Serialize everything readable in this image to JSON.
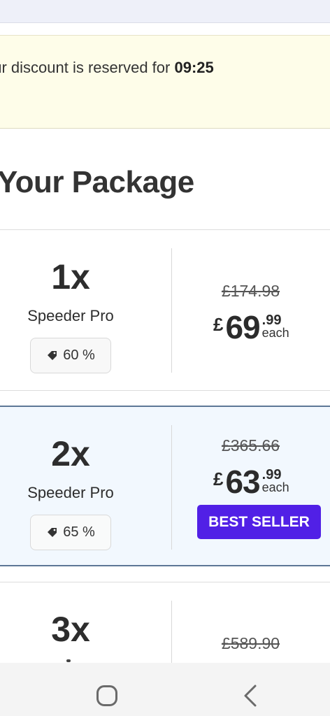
{
  "banner": {
    "text": "our discount is reserved for ",
    "timer": "09:25"
  },
  "package_title": "Your Package",
  "packages": [
    {
      "qty": "1x",
      "product": "Speeder Pro",
      "discount": "60 %",
      "old_price": "£174.98",
      "currency": "£",
      "price_whole": "69",
      "price_cents": ".99",
      "price_unit": "each"
    },
    {
      "qty": "2x",
      "product": "Speeder Pro",
      "discount": "65 %",
      "old_price": "£365.66",
      "currency": "£",
      "price_whole": "63",
      "price_cents": ".99",
      "price_unit": "each",
      "badge": "BEST SELLER",
      "highlighted": true
    },
    {
      "qty": "3x",
      "old_price": "£589.90"
    }
  ],
  "colors": {
    "banner_bg": "#fefde9",
    "highlight_bg": "#f2f8fe",
    "highlight_border": "#5d7796",
    "badge_bg": "#5120e6"
  },
  "icons": {
    "discount": "tag-icon",
    "nav_home": "home-icon",
    "nav_back": "back-icon"
  }
}
